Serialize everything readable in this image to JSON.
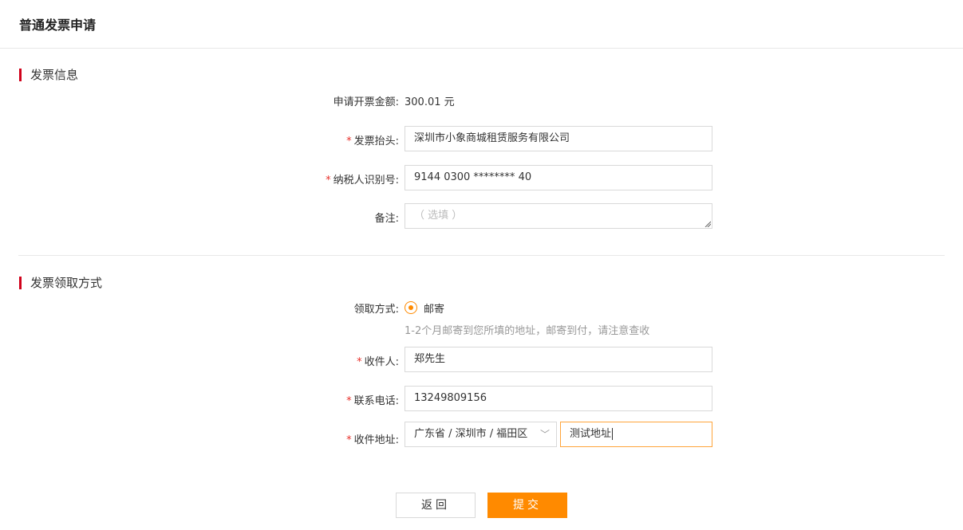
{
  "page": {
    "title": "普通发票申请"
  },
  "invoice_section": {
    "title": "发票信息",
    "amount_label": "申请开票金额:",
    "amount_value": "300.01 元",
    "header_label": "发票抬头:",
    "header_value": "深圳市小象商城租赁服务有限公司",
    "taxid_label": "纳税人识别号:",
    "taxid_value": "9144 0300 ******** 40",
    "remark_label": "备注:",
    "remark_placeholder": "（ 选填 ）"
  },
  "delivery_section": {
    "title": "发票领取方式",
    "method_label": "领取方式:",
    "method_option": "邮寄",
    "method_hint": "1-2个月邮寄到您所填的地址，邮寄到付，请注意查收",
    "recipient_label": "收件人:",
    "recipient_value": "郑先生",
    "phone_label": "联系电话:",
    "phone_value": "13249809156",
    "address_label": "收件地址:",
    "region_value": "广东省 / 深圳市 / 福田区",
    "address_value": "测试地址"
  },
  "actions": {
    "back_label": "返回",
    "submit_label": "提交"
  },
  "colors": {
    "accent": "#ff8a00",
    "required": "#e8312b",
    "section_bar": "#d0021b"
  },
  "icons": {
    "region_dropdown": "chevron-down-icon",
    "method_radio": "radio-checked-icon"
  }
}
